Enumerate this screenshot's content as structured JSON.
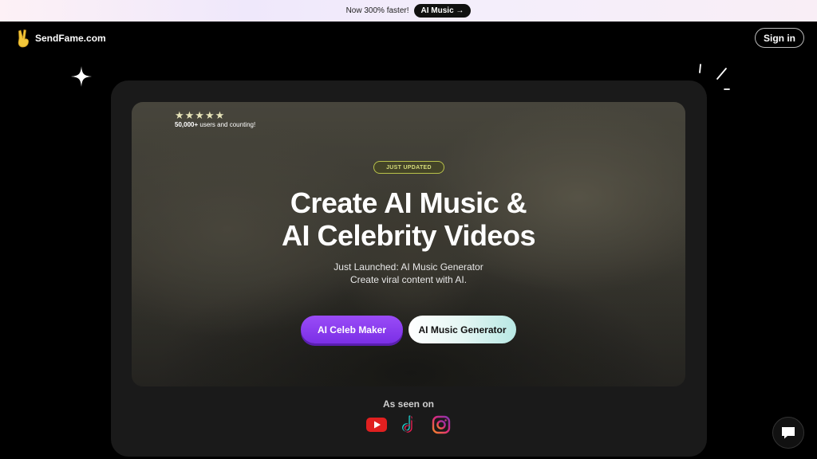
{
  "announcement": {
    "text": "Now 300% faster!",
    "pill": "AI Music →"
  },
  "header": {
    "brand": "SendFame.com",
    "signin": "Sign in"
  },
  "hero": {
    "stars": "★★★★★",
    "users_count": "50,000+",
    "users_text": " users and counting!",
    "badge": "JUST UPDATED",
    "headline_line1": "Create AI Music &",
    "headline_line2": "AI Celebrity Videos",
    "subline1": "Just Launched: AI Music Generator",
    "subline2": "Create viral content with AI.",
    "btn_primary": "AI Celeb Maker",
    "btn_secondary": "AI Music Generator"
  },
  "seen_on": {
    "label": "As seen on",
    "platforms": [
      "youtube-icon",
      "tiktok-icon",
      "instagram-icon"
    ]
  },
  "colors": {
    "accent_purple": "#8a3ff0",
    "badge_green": "#b9c24a",
    "youtube_red": "#e02020"
  }
}
